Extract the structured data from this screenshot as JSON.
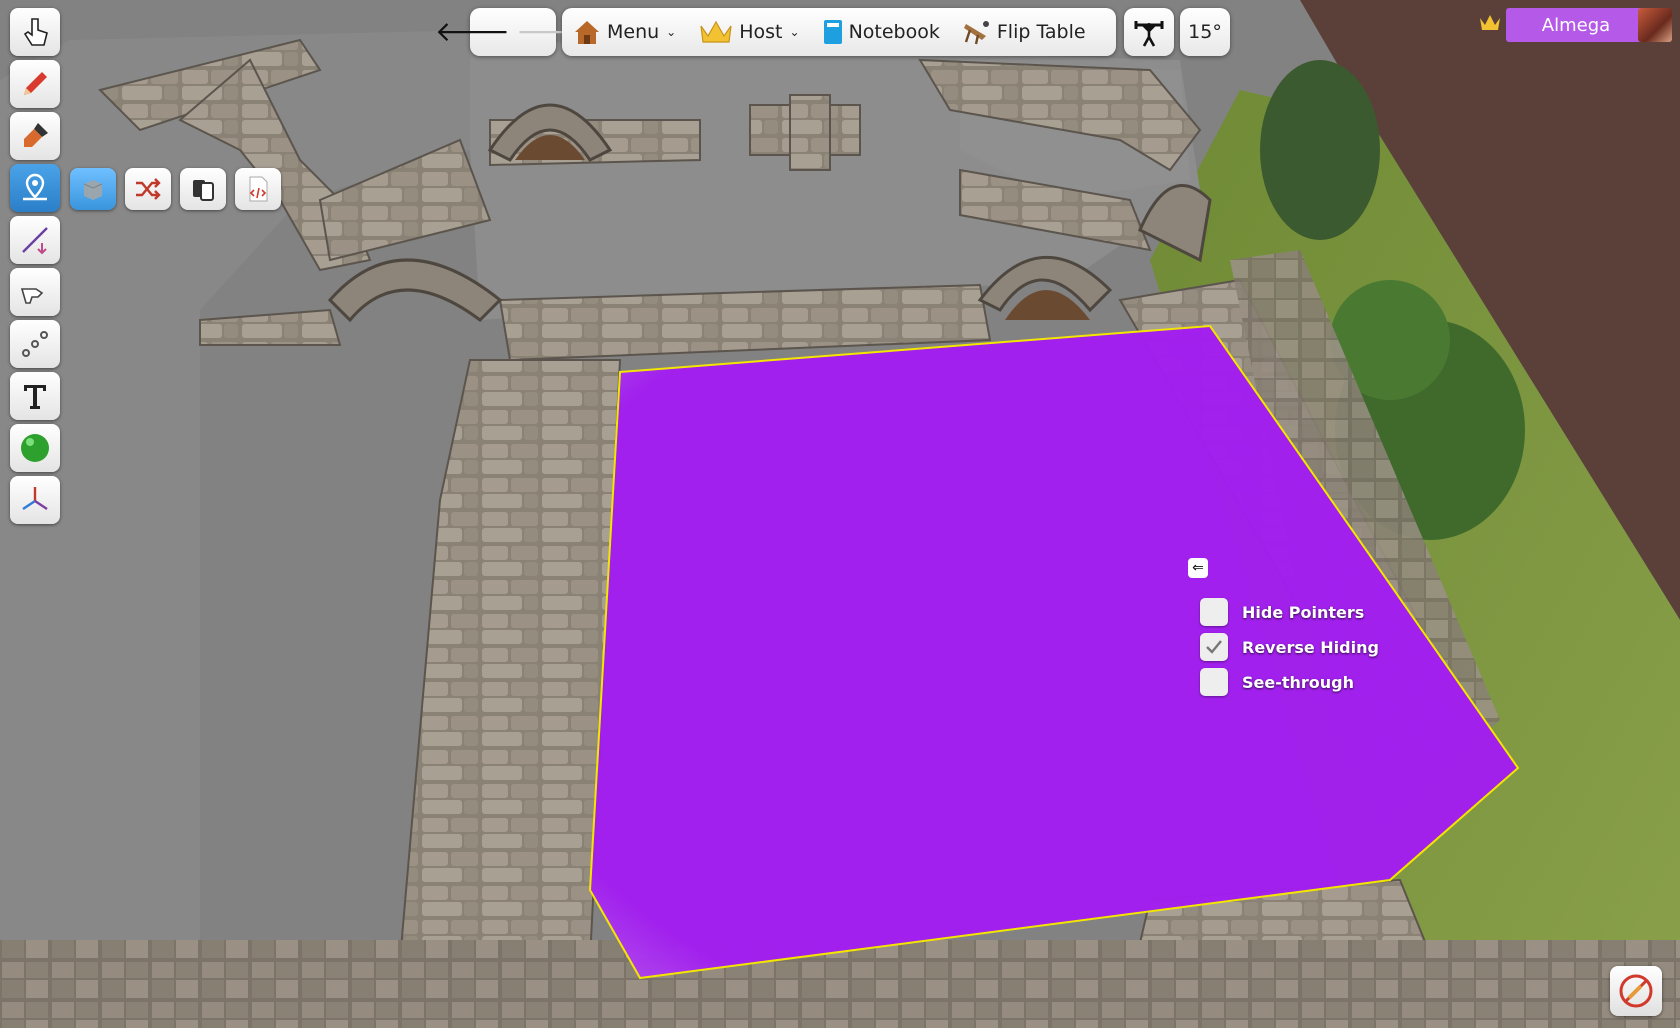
{
  "colors": {
    "zone_fill": "#a21df0",
    "zone_outline": "#f2e600",
    "user_tag": "#b55ae8"
  },
  "toolbar": {
    "tools": [
      {
        "name": "grab-tool",
        "icon": "hand-pointer-icon"
      },
      {
        "name": "line-tool",
        "icon": "pencil-icon"
      },
      {
        "name": "paint-tool",
        "icon": "brush-icon"
      },
      {
        "name": "zones-tool",
        "icon": "map-pin-icon",
        "active": true
      },
      {
        "name": "ruler-tool",
        "icon": "ruler-icon"
      },
      {
        "name": "gizmo-tool",
        "icon": "hand-gesture-icon"
      },
      {
        "name": "joint-tool",
        "icon": "chain-icon"
      },
      {
        "name": "text-tool",
        "icon": "text-icon"
      },
      {
        "name": "flick-tool",
        "icon": "green-ball-icon"
      },
      {
        "name": "axis-tool",
        "icon": "axis-icon"
      }
    ],
    "zone_subtools": [
      {
        "name": "hidden-zone",
        "icon": "cube-icon",
        "active": true
      },
      {
        "name": "randomize-zone",
        "icon": "shuffle-icon"
      },
      {
        "name": "hand-zone",
        "icon": "cards-icon"
      },
      {
        "name": "scripting-zone",
        "icon": "code-icon"
      }
    ]
  },
  "topbar": {
    "menu_label": "Menu",
    "host_label": "Host",
    "notebook_label": "Notebook",
    "flip_table_label": "Flip Table",
    "angle_label": "15°"
  },
  "user": {
    "name": "Almega"
  },
  "context_menu": {
    "options": [
      {
        "label": "Hide Pointers",
        "checked": false
      },
      {
        "label": "Reverse Hiding",
        "checked": true
      },
      {
        "label": "See-through",
        "checked": false
      }
    ]
  }
}
